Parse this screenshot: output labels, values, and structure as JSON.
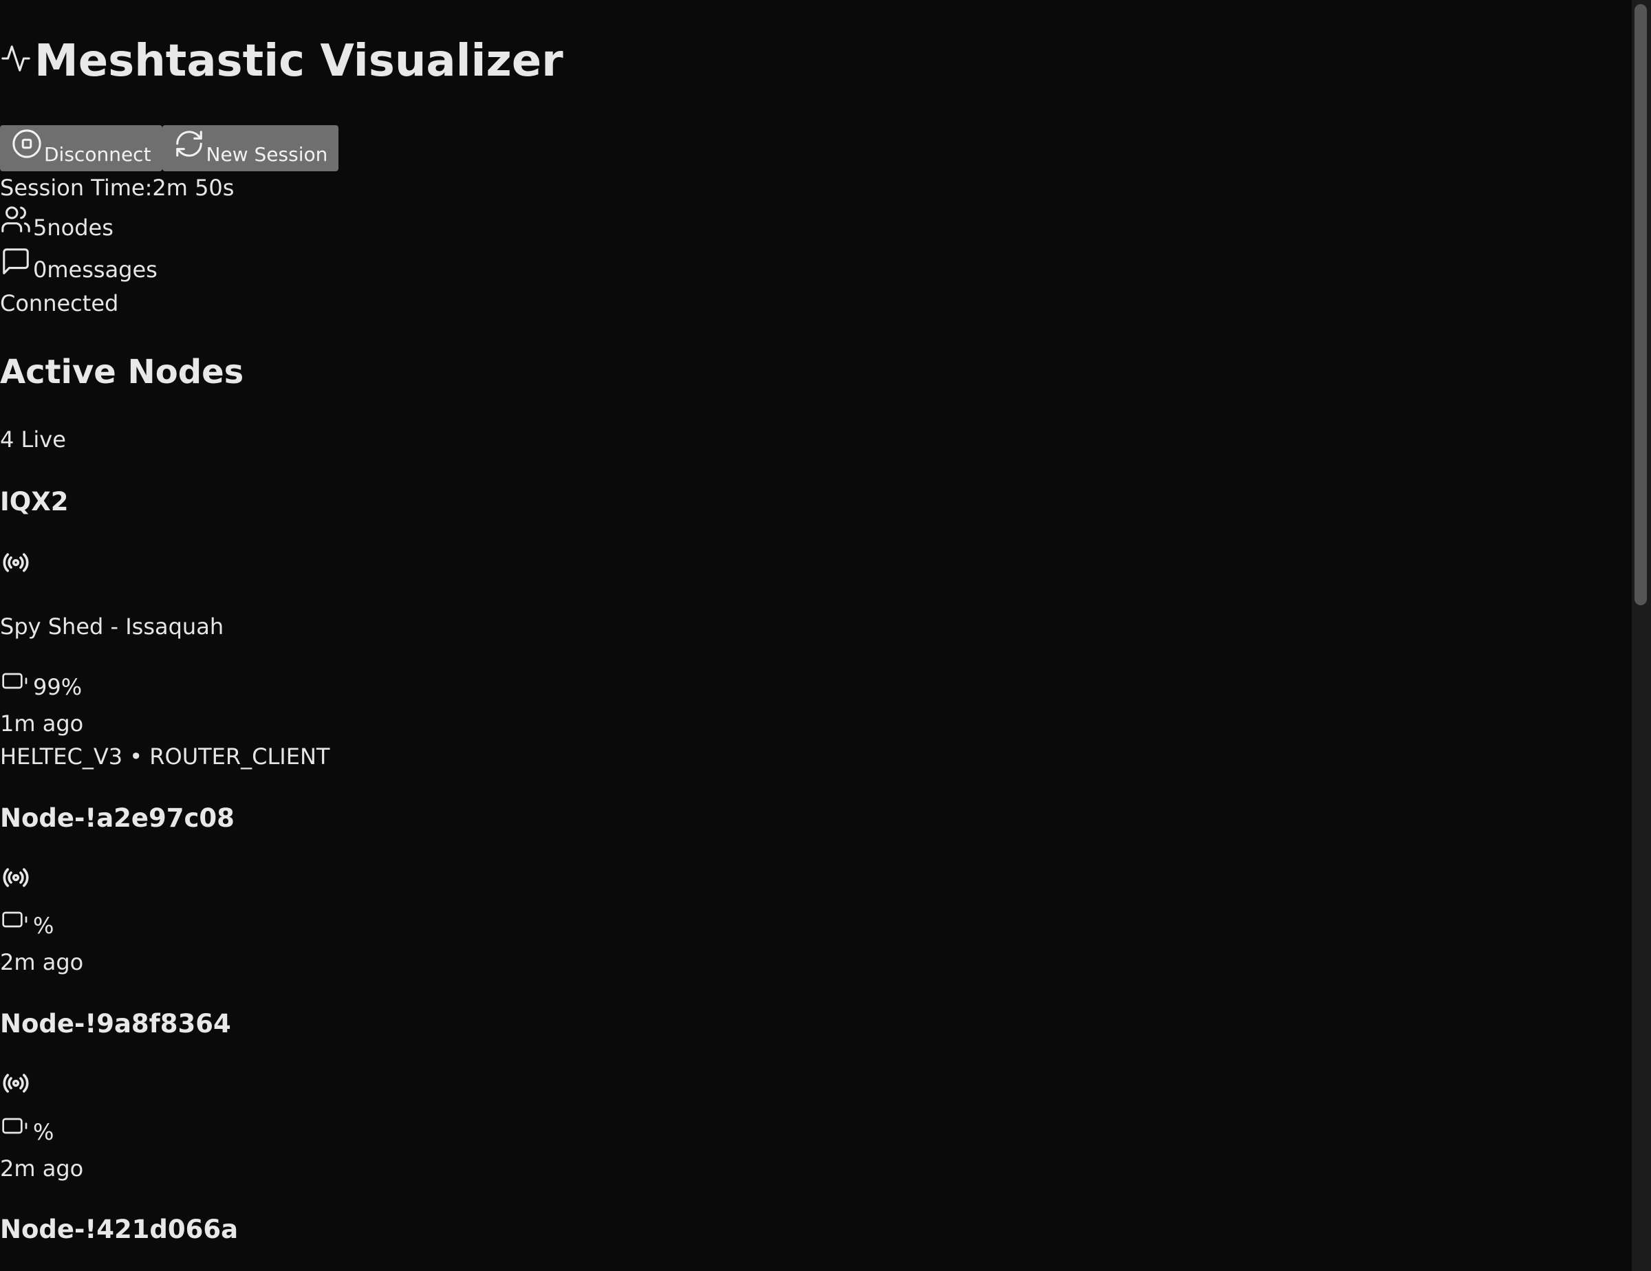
{
  "header": {
    "title": "Meshtastic Visualizer",
    "icon": "activity-icon"
  },
  "controls": {
    "disconnect_label": "Disconnect",
    "new_session_label": "New Session"
  },
  "session": {
    "time_label": "Session Time:",
    "time_value": "2m 50s",
    "nodes_count": "5",
    "nodes_unit": "nodes",
    "messages_count": "0",
    "messages_unit": "messages",
    "status": "Connected"
  },
  "active_nodes": {
    "heading": "Active Nodes",
    "live_count": "4 Live",
    "nodes": [
      {
        "name": "IQX2",
        "description": "Spy Shed - Issaquah",
        "battery": "99%",
        "last_seen": "1m ago",
        "hardware": "HELTEC_V3 • ROUTER_CLIENT"
      },
      {
        "name": "Node-!a2e97c08",
        "battery": "%",
        "last_seen": "2m ago"
      },
      {
        "name": "Node-!9a8f8364",
        "battery": "%",
        "last_seen": "2m ago"
      },
      {
        "name": "Node-!421d066a"
      }
    ]
  },
  "colors": {
    "background": "#0a0a0a",
    "text": "#e6e6e6",
    "button_bg": "#6f6f6f"
  }
}
